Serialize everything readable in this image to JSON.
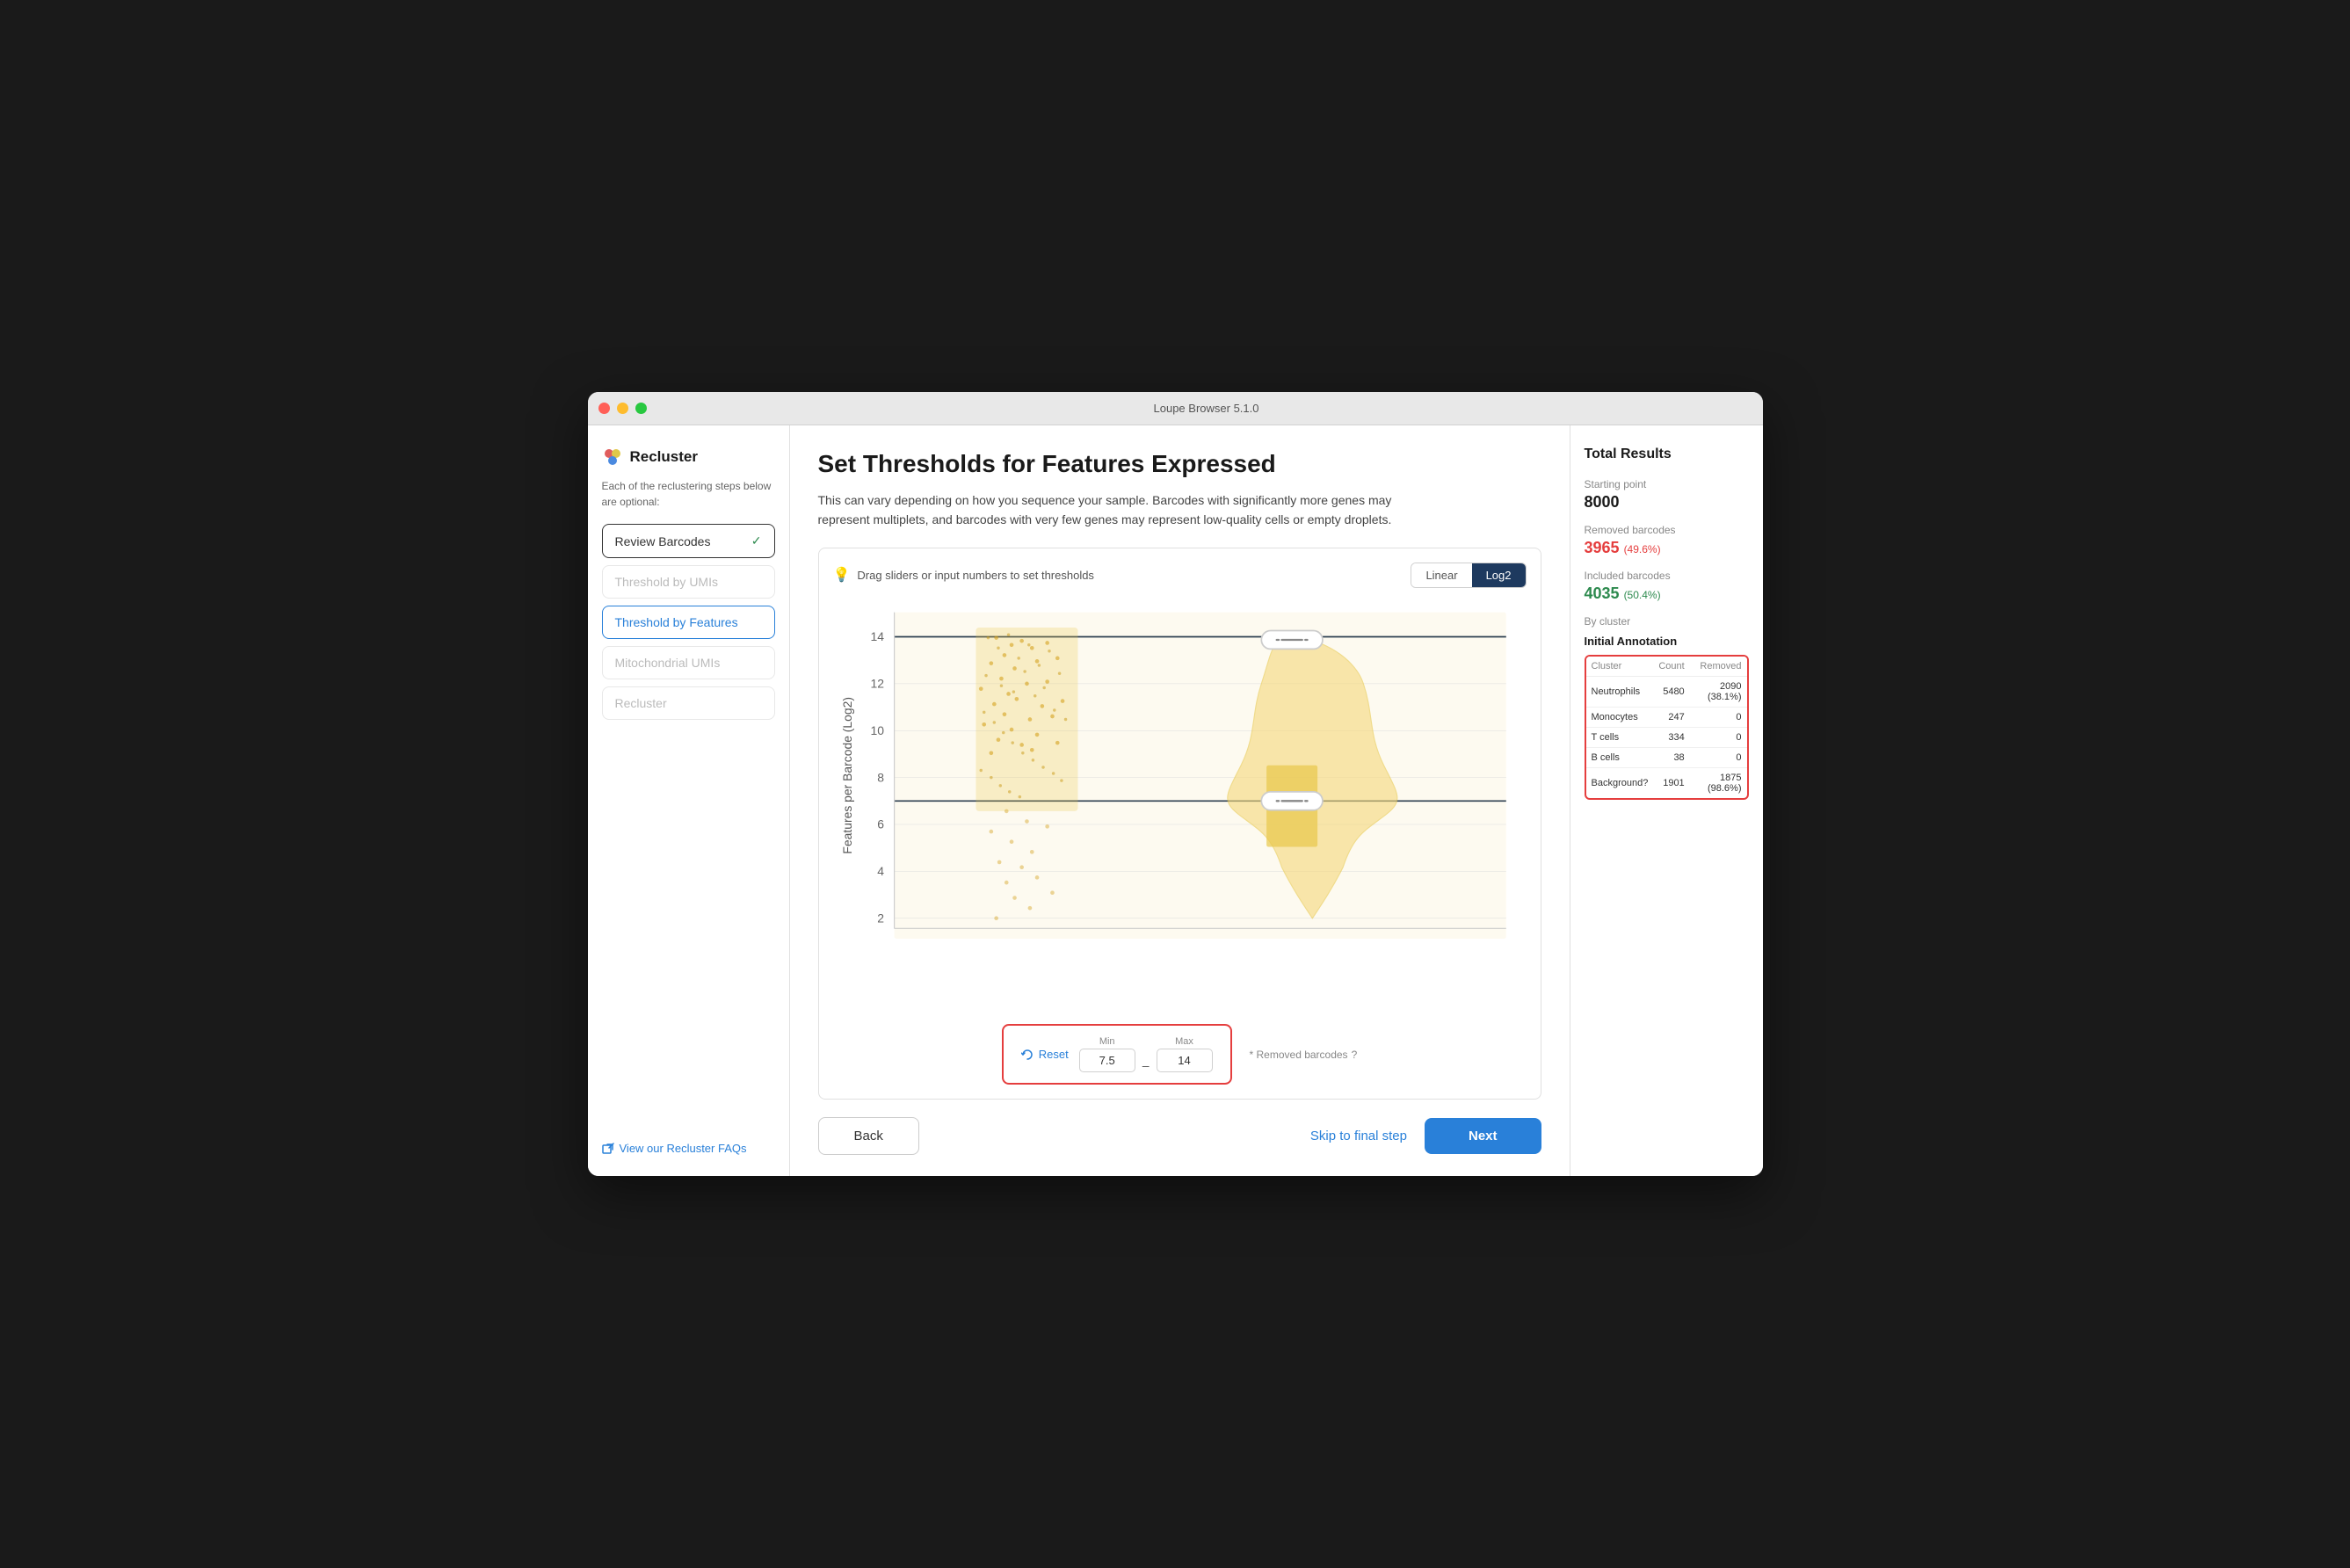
{
  "window": {
    "title": "Loupe Browser 5.1.0"
  },
  "sidebar": {
    "title": "Recluster",
    "description": "Each of the reclustering steps below are optional:",
    "nav_items": [
      {
        "id": "review-barcodes",
        "label": "Review Barcodes",
        "state": "check"
      },
      {
        "id": "threshold-umis",
        "label": "Threshold by UMIs",
        "state": "disabled"
      },
      {
        "id": "threshold-features",
        "label": "Threshold by Features",
        "state": "active"
      },
      {
        "id": "mitochondrial-umis",
        "label": "Mitochondrial UMIs",
        "state": "disabled"
      },
      {
        "id": "recluster",
        "label": "Recluster",
        "state": "disabled"
      }
    ],
    "faq_link": "View our Recluster FAQs"
  },
  "main": {
    "title": "Set Thresholds for Features Expressed",
    "description": "This can vary depending on how you sequence your sample. Barcodes with significantly more genes may represent multiplets, and barcodes with very few genes may represent low-quality cells or empty droplets.",
    "chart": {
      "hint": "Drag sliders or input numbers to set thresholds",
      "scale_linear": "Linear",
      "scale_log2": "Log2",
      "active_scale": "log2",
      "y_label": "Features per Barcode (Log2)",
      "y_ticks": [
        "2",
        "4",
        "6",
        "8",
        "10",
        "12",
        "14"
      ],
      "min_value": "7.5",
      "max_value": "14",
      "min_label": "Min",
      "max_label": "Max",
      "reset_label": "Reset",
      "removed_label": "* Removed barcodes"
    },
    "footer": {
      "back_label": "Back",
      "skip_label": "Skip to final step",
      "next_label": "Next"
    }
  },
  "right_panel": {
    "title": "Total Results",
    "starting_point_label": "Starting point",
    "starting_point_value": "8000",
    "removed_label": "Removed barcodes",
    "removed_value": "3965",
    "removed_pct": "(49.6%)",
    "included_label": "Included barcodes",
    "included_value": "4035",
    "included_pct": "(50.4%)",
    "by_cluster_label": "By cluster",
    "annotation_title": "Initial Annotation",
    "table_headers": [
      "Cluster",
      "Count",
      "Removed"
    ],
    "table_rows": [
      {
        "cluster": "Neutrophils",
        "count": "5480",
        "removed": "2090 (38.1%)"
      },
      {
        "cluster": "Monocytes",
        "count": "247",
        "removed": "0"
      },
      {
        "cluster": "T cells",
        "count": "334",
        "removed": "0"
      },
      {
        "cluster": "B cells",
        "count": "38",
        "removed": "0"
      },
      {
        "cluster": "Background?",
        "count": "1901",
        "removed": "1875 (98.6%)"
      }
    ]
  },
  "colors": {
    "accent_blue": "#2980d9",
    "accent_red": "#e53e3e",
    "accent_green": "#2d8a4e",
    "nav_dark": "#1e3a5f",
    "chart_fill": "#f5d87a",
    "chart_stroke": "#e8c84a"
  }
}
